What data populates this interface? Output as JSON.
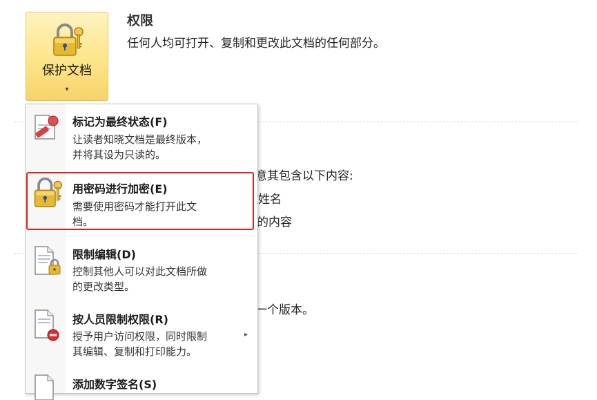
{
  "protect": {
    "label": "保护文档",
    "arrow": "▾"
  },
  "permissions": {
    "title": "权限",
    "description": "任何人均可打开、复制和更改此文档的任何部分。"
  },
  "background": {
    "line1": "意其包含以下内容:",
    "line2": "姓名",
    "line3": "的内容",
    "line4": "一个版本。"
  },
  "menu": {
    "items": [
      {
        "title": "标记为最终状态(F)",
        "desc1": "让读者知晓文档是最终版本，",
        "desc2": "并将其设为只读的。",
        "icon": "final-stamp-icon"
      },
      {
        "title": "用密码进行加密(E)",
        "desc1": "需要使用密码才能打开此文",
        "desc2": "档。",
        "icon": "lock-key-icon"
      },
      {
        "title": "限制编辑(D)",
        "desc1": "控制其他人可以对此文档所做",
        "desc2": "的更改类型。",
        "icon": "document-lock-icon"
      },
      {
        "title": "按人员限制权限(R)",
        "desc1": "授予用户访问权限，同时限制",
        "desc2": "其编辑、复制和打印能力。",
        "icon": "document-restricted-icon",
        "submenu_arrow": "▸"
      },
      {
        "title": "添加数字签名(S)",
        "icon": "digital-signature-icon"
      }
    ]
  },
  "colors": {
    "button_gold": "#fde58a",
    "highlight_red": "#e02020",
    "lock_gold": "#e8b82e"
  }
}
